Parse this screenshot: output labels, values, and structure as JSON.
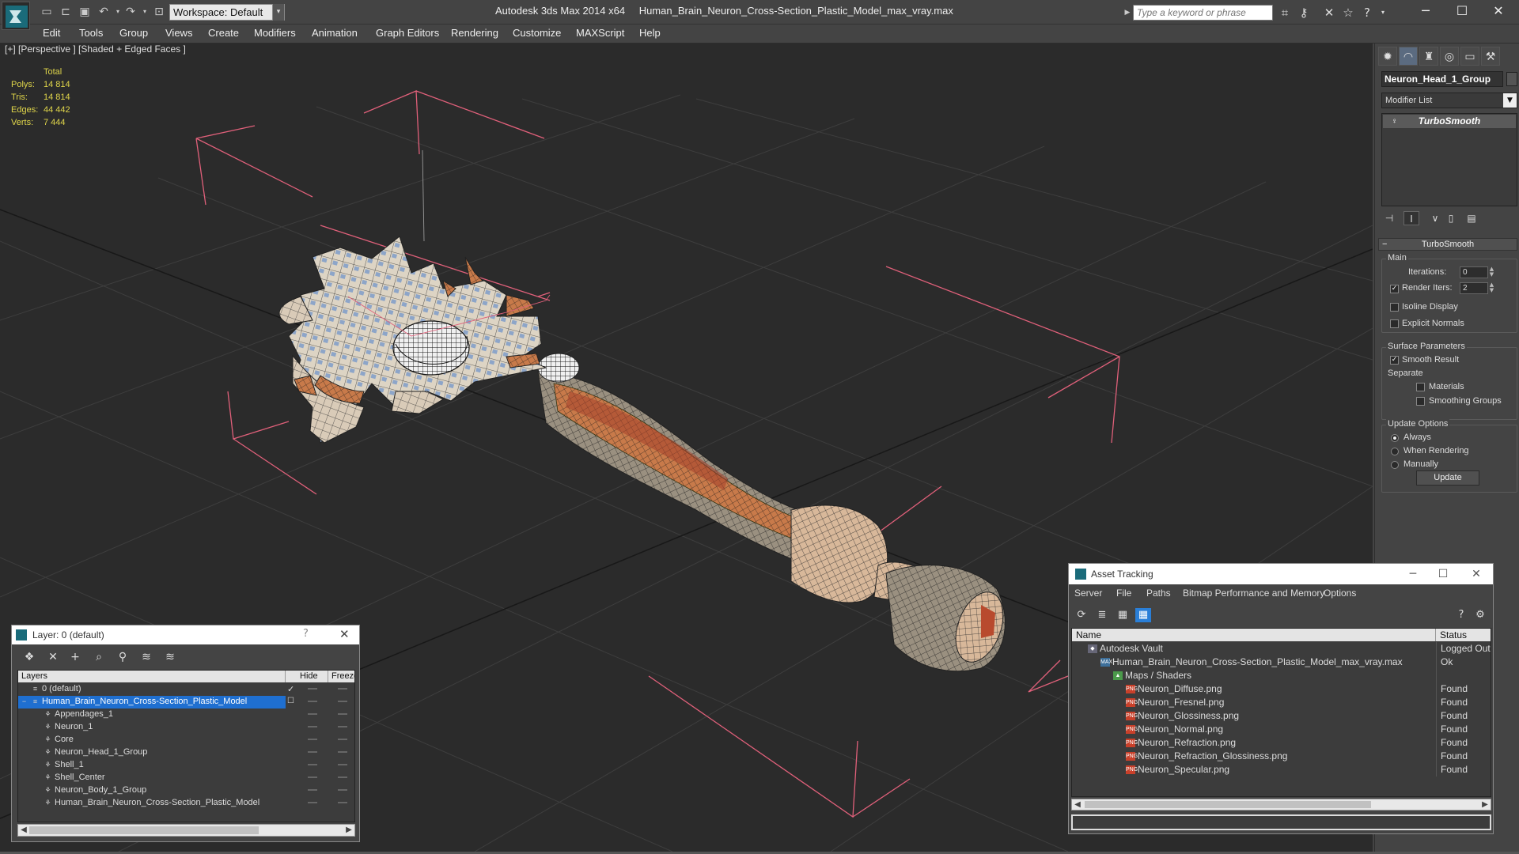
{
  "titlebar": {
    "workspace": "Workspace: Default",
    "app_name": "Autodesk 3ds Max  2014 x64",
    "file_name": "Human_Brain_Neuron_Cross-Section_Plastic_Model_max_vray.max",
    "search_placeholder": "Type a keyword or phrase"
  },
  "menubar": {
    "items": [
      "Edit",
      "Tools",
      "Group",
      "Views",
      "Create",
      "Modifiers",
      "Animation",
      "Graph Editors",
      "Rendering",
      "Customize",
      "MAXScript",
      "Help"
    ]
  },
  "viewport": {
    "label": "[+] [Perspective ] [Shaded + Edged Faces ]",
    "stats": {
      "header": "Total",
      "rows": [
        {
          "label": "Polys:",
          "value": "14 814"
        },
        {
          "label": "Tris:",
          "value": "14 814"
        },
        {
          "label": "Edges:",
          "value": "44 442"
        },
        {
          "label": "Verts:",
          "value": "7 444"
        }
      ]
    }
  },
  "command_panel": {
    "object_name": "Neuron_Head_1_Group",
    "modifier_list": "Modifier List",
    "stack_item": "TurboSmooth",
    "rollout_title": "TurboSmooth",
    "main_group": "Main",
    "iterations_label": "Iterations:",
    "iterations_value": "0",
    "render_iters_label": "Render Iters:",
    "render_iters_value": "2",
    "render_iters_checked": true,
    "isoline_label": "Isoline Display",
    "explicit_label": "Explicit Normals",
    "surface_group": "Surface Parameters",
    "smooth_result_label": "Smooth Result",
    "separate_label": "Separate",
    "materials_label": "Materials",
    "smoothing_groups_label": "Smoothing Groups",
    "update_group": "Update Options",
    "always_label": "Always",
    "when_rendering_label": "When Rendering",
    "manually_label": "Manually",
    "update_button": "Update"
  },
  "layer_dialog": {
    "title": "Layer: 0 (default)",
    "help": "?",
    "columns": [
      "Layers",
      "Hide",
      "Freeze"
    ],
    "rows": [
      {
        "name": "0 (default)",
        "level": 0,
        "checked": true
      },
      {
        "name": "Human_Brain_Neuron_Cross-Section_Plastic_Model",
        "level": 0,
        "selected": true
      },
      {
        "name": "Appendages_1",
        "level": 1
      },
      {
        "name": "Neuron_1",
        "level": 1
      },
      {
        "name": "Core",
        "level": 1
      },
      {
        "name": "Neuron_Head_1_Group",
        "level": 1
      },
      {
        "name": "Shell_1",
        "level": 1
      },
      {
        "name": "Shell_Center",
        "level": 1
      },
      {
        "name": "Neuron_Body_1_Group",
        "level": 1
      },
      {
        "name": "Human_Brain_Neuron_Cross-Section_Plastic_Model",
        "level": 1
      }
    ]
  },
  "asset_dialog": {
    "title": "Asset Tracking",
    "menu": [
      "Server",
      "File",
      "Paths",
      "Bitmap Performance and Memory",
      "Options"
    ],
    "columns": [
      "Name",
      "Status"
    ],
    "rows": [
      {
        "name": "Autodesk Vault",
        "status": "Logged Out",
        "level": 0,
        "icon": "vault-icon"
      },
      {
        "name": "Human_Brain_Neuron_Cross-Section_Plastic_Model_max_vray.max",
        "status": "Ok",
        "level": 1,
        "icon": "max-file-icon"
      },
      {
        "name": "Maps / Shaders",
        "status": "",
        "level": 2,
        "icon": "maps-icon"
      },
      {
        "name": "Neuron_Diffuse.png",
        "status": "Found",
        "level": 3,
        "icon": "png-icon"
      },
      {
        "name": "Neuron_Fresnel.png",
        "status": "Found",
        "level": 3,
        "icon": "png-icon"
      },
      {
        "name": "Neuron_Glossiness.png",
        "status": "Found",
        "level": 3,
        "icon": "png-icon"
      },
      {
        "name": "Neuron_Normal.png",
        "status": "Found",
        "level": 3,
        "icon": "png-icon"
      },
      {
        "name": "Neuron_Refraction.png",
        "status": "Found",
        "level": 3,
        "icon": "png-icon"
      },
      {
        "name": "Neuron_Refraction_Glossiness.png",
        "status": "Found",
        "level": 3,
        "icon": "png-icon"
      },
      {
        "name": "Neuron_Specular.png",
        "status": "Found",
        "level": 3,
        "icon": "png-icon"
      }
    ]
  },
  "colors": {
    "viewport_bg": "#2b2b2b",
    "stats_text": "#e0d64a",
    "selection": "#1f6fd0",
    "bbox_lines": "#e0607a"
  }
}
